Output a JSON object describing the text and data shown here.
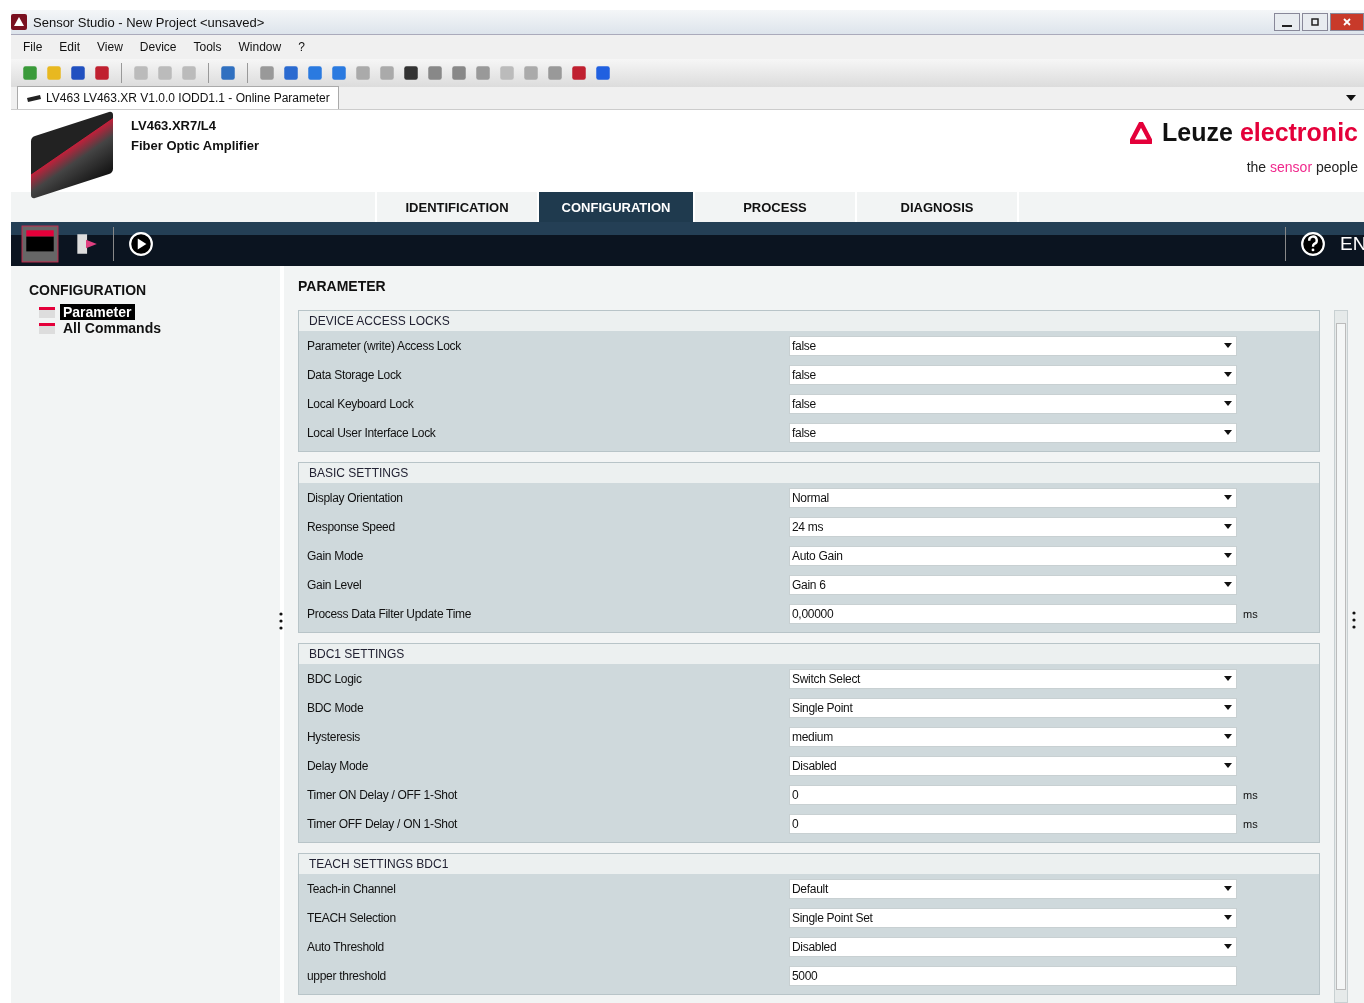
{
  "window": {
    "title": "Sensor Studio - New Project  <unsaved>"
  },
  "menu": [
    "File",
    "Edit",
    "View",
    "Device",
    "Tools",
    "Window",
    "?"
  ],
  "document_tab": {
    "label": "LV463 LV463.XR V1.0.0 IODD1.1 - Online Parameter"
  },
  "device": {
    "model": "LV463.XR7/L4",
    "description": "Fiber Optic Amplifier"
  },
  "logo": {
    "brand_dark": "Leuze",
    "brand_accent": "electronic",
    "tagline_start": "the",
    "tagline_accent": "sensor",
    "tagline_end": "people"
  },
  "tabs": [
    {
      "label": "IDENTIFICATION",
      "selected": false
    },
    {
      "label": "CONFIGURATION",
      "selected": true
    },
    {
      "label": "PROCESS",
      "selected": false
    },
    {
      "label": "DIAGNOSIS",
      "selected": false
    }
  ],
  "language": "EN",
  "sidebar": {
    "title": "CONFIGURATION",
    "items": [
      {
        "label": "Parameter",
        "selected": true
      },
      {
        "label": "All Commands",
        "selected": false
      }
    ]
  },
  "content": {
    "title": "PARAMETER",
    "groups": [
      {
        "title": "DEVICE ACCESS LOCKS",
        "rows": [
          {
            "label": "Parameter (write) Access Lock",
            "kind": "select",
            "value": "false"
          },
          {
            "label": "Data Storage Lock",
            "kind": "select",
            "value": "false"
          },
          {
            "label": "Local Keyboard Lock",
            "kind": "select",
            "value": "false"
          },
          {
            "label": "Local User Interface Lock",
            "kind": "select",
            "value": "false"
          }
        ]
      },
      {
        "title": "BASIC SETTINGS",
        "rows": [
          {
            "label": "Display Orientation",
            "kind": "select",
            "value": "Normal"
          },
          {
            "label": "Response Speed",
            "kind": "select",
            "value": "24 ms"
          },
          {
            "label": "Gain Mode",
            "kind": "select",
            "value": "Auto Gain"
          },
          {
            "label": "Gain Level",
            "kind": "select",
            "value": "Gain 6"
          },
          {
            "label": "Process Data Filter Update Time",
            "kind": "input",
            "value": "0,00000",
            "unit": "ms"
          }
        ]
      },
      {
        "title": "BDC1 SETTINGS",
        "rows": [
          {
            "label": "BDC Logic",
            "kind": "select",
            "value": "Switch Select"
          },
          {
            "label": "BDC Mode",
            "kind": "select",
            "value": "Single Point"
          },
          {
            "label": "Hysteresis",
            "kind": "select",
            "value": "medium"
          },
          {
            "label": "Delay Mode",
            "kind": "select",
            "value": "Disabled"
          },
          {
            "label": "Timer ON Delay / OFF 1-Shot",
            "kind": "input",
            "value": "0",
            "unit": "ms"
          },
          {
            "label": "Timer OFF Delay / ON 1-Shot",
            "kind": "input",
            "value": "0",
            "unit": "ms"
          }
        ]
      },
      {
        "title": "TEACH SETTINGS BDC1",
        "rows": [
          {
            "label": "Teach-in Channel",
            "kind": "select",
            "value": "Default"
          },
          {
            "label": "TEACH Selection",
            "kind": "select",
            "value": "Single Point Set"
          },
          {
            "label": "Auto Threshold",
            "kind": "select",
            "value": "Disabled"
          },
          {
            "label": "upper threshold",
            "kind": "input",
            "value": "5000"
          }
        ]
      }
    ]
  }
}
